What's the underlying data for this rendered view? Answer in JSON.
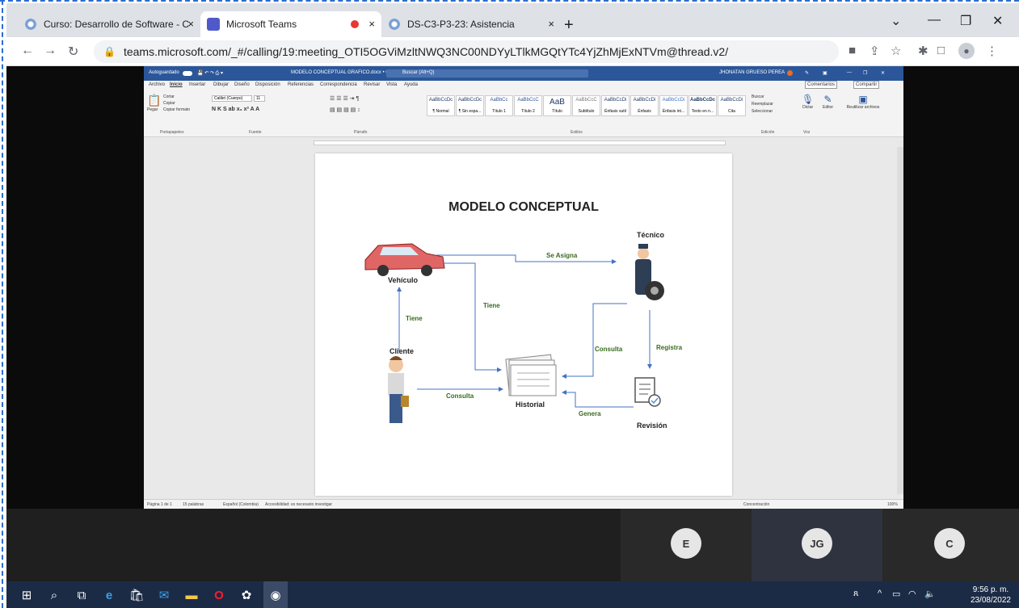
{
  "browser": {
    "tabs": [
      {
        "title": "Curso: Desarrollo de Software - C",
        "close": "×"
      },
      {
        "title": "Microsoft Teams",
        "close": "×"
      },
      {
        "title": "DS-C3-P3-23: Asistencia",
        "close": "×"
      }
    ],
    "new_tab": "+",
    "url": "teams.microsoft.com/_#/calling/19:meeting_OTI5OGViMzltNWQ3NC00NDYyLTlkMGQtYTc4YjZhMjExNTVm@thread.v2/"
  },
  "word": {
    "title_bar": {
      "autosave": "Autoguardado",
      "doc_title": "MODELO CONCEPTUAL GRAFICO.docx • Guardado",
      "search": "Buscar (Alt+Q)",
      "user": "JHONATAN GRUESO PEREA"
    },
    "menu_tabs": [
      "Archivo",
      "Inicio",
      "Insertar",
      "Dibujar",
      "Diseño",
      "Disposición",
      "Referencias",
      "Correspondencia",
      "Revisar",
      "Vista",
      "Ayuda"
    ],
    "comments": "Comentarios",
    "share": "Compartir",
    "clipboard": {
      "paste": "Pegar",
      "cut": "Cortar",
      "copy": "Copiar",
      "format": "Copiar formato",
      "label": "Portapapeles"
    },
    "font": {
      "name": "Calibri (Cuerpo)",
      "size": "11",
      "label": "Fuente"
    },
    "paragraph_label": "Párrafo",
    "styles": [
      {
        "preview": "AaBbCcDc",
        "name": "¶ Normal"
      },
      {
        "preview": "AaBbCcDc",
        "name": "¶ Sin espa..."
      },
      {
        "preview": "AaBbCc",
        "name": "Título 1"
      },
      {
        "preview": "AaBbCcC",
        "name": "Título 2"
      },
      {
        "preview": "AaB",
        "name": "Título"
      },
      {
        "preview": "AaBbCcC",
        "name": "Subtítulo"
      },
      {
        "preview": "AaBbCcDi",
        "name": "Énfasis sutil"
      },
      {
        "preview": "AaBbCcDi",
        "name": "Énfasis"
      },
      {
        "preview": "AaBbCcDi",
        "name": "Énfasis int..."
      },
      {
        "preview": "AaBbCcDc",
        "name": "Texto en n..."
      },
      {
        "preview": "AaBbCcDi",
        "name": "Cita"
      }
    ],
    "styles_label": "Estilos",
    "editing": {
      "find": "Buscar",
      "replace": "Reemplazar",
      "select": "Seleccionar",
      "label": "Edición"
    },
    "dictate": "Dictar",
    "voice_label": "Voz",
    "editor": "Editor",
    "reuse": "Reutilizar archivos",
    "status": {
      "page": "Página 1 de 1",
      "words": "15 palabras",
      "lang": "Español (Colombia)",
      "accessibility": "Accesibilidad: es necesario investigar",
      "focus": "Concentración",
      "zoom": "100%"
    },
    "diagram": {
      "title": "MODELO CONCEPTUAL",
      "nodes": {
        "vehiculo": "Vehículo",
        "tecnico": "Técnico",
        "cliente": "Cliente",
        "historial": "Historial",
        "revision": "Revisión"
      },
      "edges": {
        "se_asigna": "Se Asigna",
        "tiene1": "Tiene",
        "tiene2": "Tiene",
        "consulta1": "Consulta",
        "consulta2": "Consulta",
        "registra": "Registra",
        "genera": "Genera"
      }
    }
  },
  "participants": [
    {
      "initial": "E"
    },
    {
      "initial": "JG"
    },
    {
      "initial": "C"
    }
  ],
  "taskbar": {
    "time": "9:56 p. m.",
    "date": "23/08/2022"
  }
}
